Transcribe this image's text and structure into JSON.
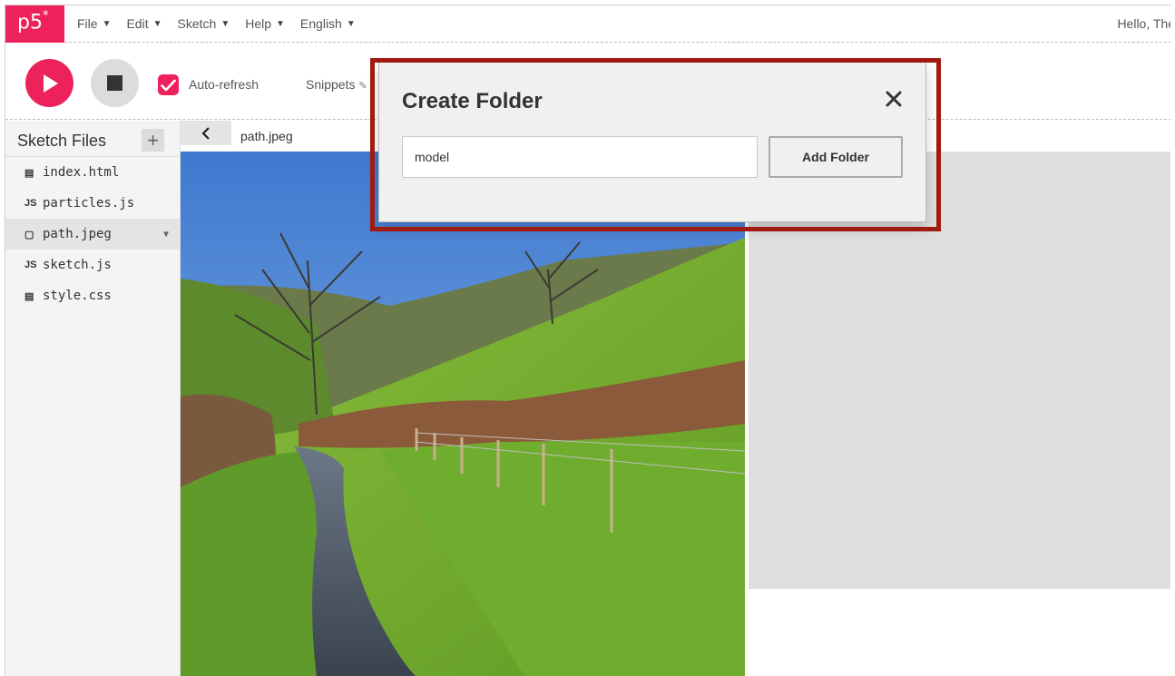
{
  "nav": {
    "logo": "p5",
    "logo_sup": "*",
    "menu": [
      {
        "label": "File"
      },
      {
        "label": "Edit"
      },
      {
        "label": "Sketch"
      },
      {
        "label": "Help"
      },
      {
        "label": "English"
      }
    ],
    "greeting": "Hello, The"
  },
  "toolbar": {
    "auto_refresh_label": "Auto-refresh",
    "auto_refresh_checked": true,
    "snippets_label": "Snippets"
  },
  "sidebar": {
    "title": "Sketch Files",
    "add_symbol": "+",
    "files": [
      {
        "icon": "html-icon",
        "glyph": "▤",
        "name": "index.html",
        "selected": false
      },
      {
        "icon": "js-icon",
        "glyph": "JS",
        "name": "particles.js",
        "selected": false
      },
      {
        "icon": "file-icon",
        "glyph": "▢",
        "name": "path.jpeg",
        "selected": true
      },
      {
        "icon": "js-icon",
        "glyph": "JS",
        "name": "sketch.js",
        "selected": false
      },
      {
        "icon": "css-icon",
        "glyph": "▤",
        "name": "style.css",
        "selected": false
      }
    ]
  },
  "editor": {
    "tab_name": "path.jpeg"
  },
  "modal": {
    "title": "Create Folder",
    "input_value": "model",
    "button_label": "Add Folder"
  },
  "colors": {
    "brand": "#ed225d",
    "highlight": "#a01a0f"
  }
}
